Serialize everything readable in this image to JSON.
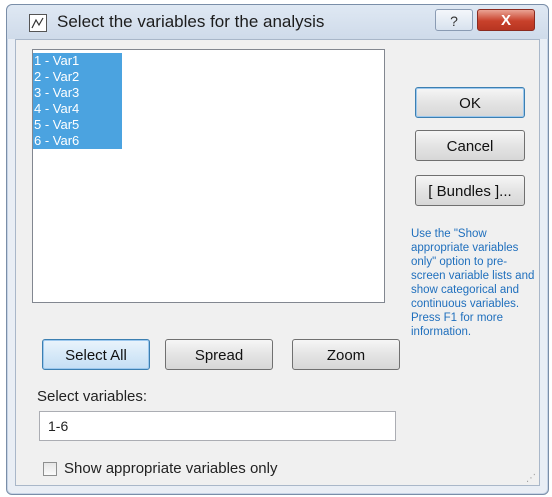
{
  "window": {
    "title": "Select the variables for the analysis",
    "help_glyph": "?",
    "close_glyph": "X"
  },
  "variables": {
    "items": [
      "1 - Var1",
      "2 - Var2",
      "3 - Var3",
      "4 - Var4",
      "5 - Var5",
      "6 - Var6"
    ],
    "selection_color": "#4ba3e0"
  },
  "buttons": {
    "ok": "OK",
    "cancel": "Cancel",
    "bundles": "[ Bundles ]...",
    "select_all": "Select All",
    "spread": "Spread",
    "zoom": "Zoom"
  },
  "hint": {
    "text": "Use the \"Show appropriate variables only\" option to pre-screen variable lists and show categorical and continuous variables. Press F1 for more information.",
    "color": "#1f6fbd"
  },
  "select": {
    "label": "Select variables:",
    "value": "1-6"
  },
  "show_appropriate": {
    "label": "Show appropriate variables only",
    "checked": false
  }
}
